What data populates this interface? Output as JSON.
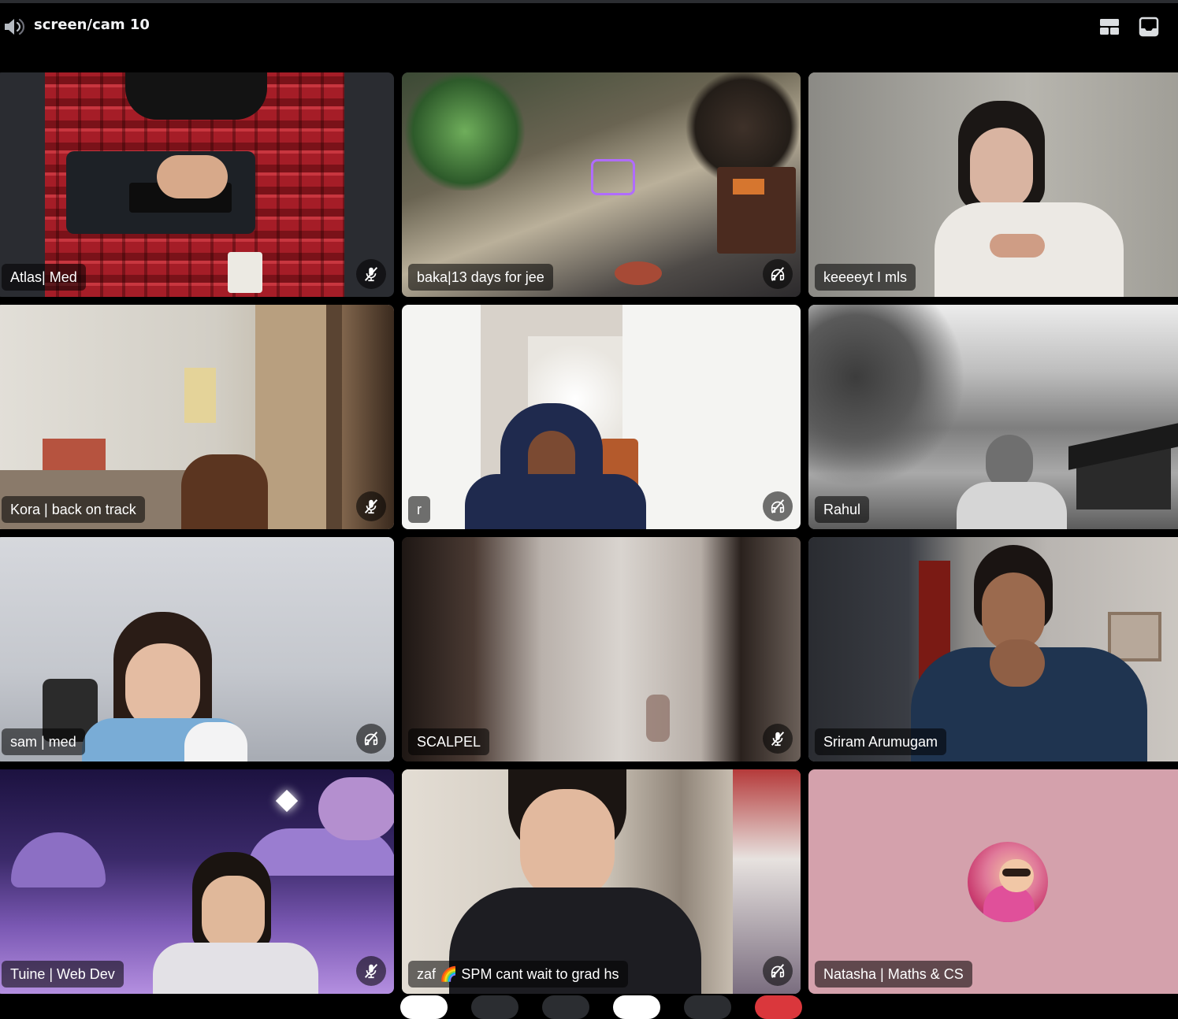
{
  "header": {
    "title": "screen/cam 10",
    "icons": {
      "voice": "speaker-icon",
      "grid_layout": "grid-layout-icon",
      "popout": "popout-icon"
    }
  },
  "tiles": [
    {
      "name": "Atlas| Med",
      "status": "muted-mic"
    },
    {
      "name": "baka|13 days for jee",
      "status": "deafened"
    },
    {
      "name": "keeeeyt I mls",
      "status": ""
    },
    {
      "name": "Kora | back on track",
      "status": "muted-mic"
    },
    {
      "name": "r",
      "status": "deafened"
    },
    {
      "name": "Rahul",
      "status": ""
    },
    {
      "name": "sam | med",
      "status": "deafened"
    },
    {
      "name": "SCALPEL",
      "status": "muted-mic"
    },
    {
      "name": "Sriram Arumugam",
      "status": ""
    },
    {
      "name": "Tuine | Web Dev",
      "status": "muted-mic"
    },
    {
      "name": "zaf 🌈 SPM cant wait to grad hs",
      "status": "deafened"
    },
    {
      "name": "Natasha | Maths & CS",
      "status": ""
    }
  ],
  "colors": {
    "background": "#000000",
    "tile_label_bg": "rgba(0,0,0,0.55)",
    "natasha_tile": "#d4a1ac"
  }
}
